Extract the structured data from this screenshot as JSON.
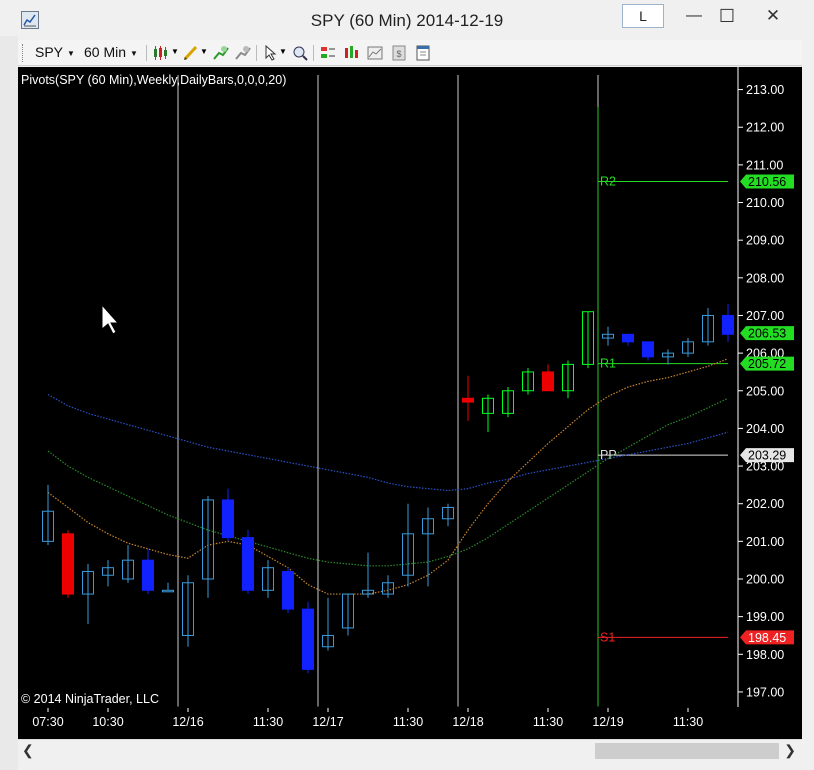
{
  "window": {
    "title": "SPY (60 Min)  2014-12-19",
    "link_button_label": "L",
    "minimize_glyph": "—",
    "maximize_glyph": "☐",
    "close_glyph": "✕"
  },
  "toolbar": {
    "instrument": "SPY",
    "interval": "60 Min",
    "icons": [
      "bar-type-icon",
      "drawing-pencil-icon",
      "add-indicator-icon",
      "remove-indicator-icon",
      "pointer-cursor-icon",
      "zoom-icon",
      "strategies-icon",
      "chart-properties-icon",
      "data-box-icon",
      "snapshot-icon",
      "template-icon"
    ]
  },
  "chart": {
    "indicator_label": "Pivots(SPY (60 Min),Weekly,DailyBars,0,0,0,20)",
    "copyright": "© 2014 NinjaTrader, LLC"
  },
  "chart_data": {
    "type": "candlestick",
    "instrument": "SPY",
    "interval": "60 Min",
    "ylim": [
      196.6,
      213.6
    ],
    "y_ticks": [
      "213.00",
      "212.00",
      "211.00",
      "210.00",
      "209.00",
      "208.00",
      "207.00",
      "206.00",
      "205.00",
      "204.00",
      "203.00",
      "202.00",
      "201.00",
      "200.00",
      "199.00",
      "198.00",
      "197.00"
    ],
    "x_labels": [
      {
        "label": "07:30",
        "bar": 0
      },
      {
        "label": "10:30",
        "bar": 3
      },
      {
        "label": "12/16",
        "bar": 7
      },
      {
        "label": "11:30",
        "bar": 11
      },
      {
        "label": "12/17",
        "bar": 14
      },
      {
        "label": "11:30",
        "bar": 18
      },
      {
        "label": "12/18",
        "bar": 21
      },
      {
        "label": "11:30",
        "bar": 25
      },
      {
        "label": "12/19",
        "bar": 28
      },
      {
        "label": "11:30",
        "bar": 32
      }
    ],
    "session_breaks": [
      6.5,
      13.5,
      20.5,
      27.5
    ],
    "candles": [
      {
        "o": 201.0,
        "h": 202.5,
        "l": 200.9,
        "c": 201.8
      },
      {
        "o": 201.2,
        "h": 201.3,
        "l": 199.5,
        "c": 199.6
      },
      {
        "o": 199.6,
        "h": 200.4,
        "l": 198.8,
        "c": 200.2
      },
      {
        "o": 200.1,
        "h": 200.5,
        "l": 199.8,
        "c": 200.3
      },
      {
        "o": 200.0,
        "h": 200.9,
        "l": 199.9,
        "c": 200.5
      },
      {
        "o": 200.5,
        "h": 200.8,
        "l": 199.6,
        "c": 199.7
      },
      {
        "o": 199.7,
        "h": 199.9,
        "l": 199.7,
        "c": 199.7
      },
      {
        "o": 198.5,
        "h": 200.1,
        "l": 198.2,
        "c": 199.9
      },
      {
        "o": 200.0,
        "h": 202.2,
        "l": 199.5,
        "c": 202.1
      },
      {
        "o": 202.1,
        "h": 202.4,
        "l": 201.0,
        "c": 201.1
      },
      {
        "o": 201.1,
        "h": 201.3,
        "l": 199.6,
        "c": 199.7
      },
      {
        "o": 199.7,
        "h": 200.5,
        "l": 199.5,
        "c": 200.3
      },
      {
        "o": 200.2,
        "h": 200.3,
        "l": 199.1,
        "c": 199.2
      },
      {
        "o": 199.2,
        "h": 199.4,
        "l": 197.5,
        "c": 197.6
      },
      {
        "o": 198.2,
        "h": 199.5,
        "l": 198.1,
        "c": 198.5
      },
      {
        "o": 198.7,
        "h": 199.6,
        "l": 198.5,
        "c": 199.6
      },
      {
        "o": 199.6,
        "h": 200.7,
        "l": 199.5,
        "c": 199.7
      },
      {
        "o": 199.6,
        "h": 200.1,
        "l": 199.5,
        "c": 199.9
      },
      {
        "o": 200.1,
        "h": 202.0,
        "l": 199.8,
        "c": 201.2
      },
      {
        "o": 201.2,
        "h": 201.9,
        "l": 199.8,
        "c": 201.6
      },
      {
        "o": 201.6,
        "h": 202.0,
        "l": 201.4,
        "c": 201.9
      },
      {
        "o": 204.8,
        "h": 205.4,
        "l": 204.2,
        "c": 204.7
      },
      {
        "o": 204.4,
        "h": 204.9,
        "l": 203.9,
        "c": 204.8
      },
      {
        "o": 204.4,
        "h": 205.1,
        "l": 204.3,
        "c": 205.0
      },
      {
        "o": 205.0,
        "h": 205.6,
        "l": 204.9,
        "c": 205.5
      },
      {
        "o": 205.5,
        "h": 205.7,
        "l": 205.0,
        "c": 205.0
      },
      {
        "o": 205.0,
        "h": 205.8,
        "l": 204.8,
        "c": 205.7
      },
      {
        "o": 205.7,
        "h": 207.1,
        "l": 205.6,
        "c": 207.1
      },
      {
        "o": 206.4,
        "h": 206.7,
        "l": 206.2,
        "c": 206.5
      },
      {
        "o": 206.5,
        "h": 206.5,
        "l": 206.2,
        "c": 206.3
      },
      {
        "o": 206.3,
        "h": 206.3,
        "l": 205.8,
        "c": 205.9
      },
      {
        "o": 205.9,
        "h": 206.1,
        "l": 205.7,
        "c": 206.0
      },
      {
        "o": 206.0,
        "h": 206.4,
        "l": 205.9,
        "c": 206.3
      },
      {
        "o": 206.3,
        "h": 207.2,
        "l": 206.2,
        "c": 207.0
      },
      {
        "o": 207.0,
        "h": 207.3,
        "l": 206.3,
        "c": 206.5
      }
    ],
    "colors": {
      "up_body": "#00ff22",
      "down_body": "#ee0000",
      "up_prev_session": "#3a9bdc",
      "down_prev_session": "#1122ff",
      "axis_text": "#ffffff",
      "session_line": "#cccccc"
    },
    "moving_averages": [
      {
        "color": "#2a52c8",
        "values": [
          204.9,
          204.6,
          204.4,
          204.25,
          204.1,
          203.95,
          203.8,
          203.65,
          203.5,
          203.4,
          203.3,
          203.2,
          203.1,
          203.0,
          202.9,
          202.8,
          202.7,
          202.55,
          202.45,
          202.4,
          202.35,
          202.4,
          202.55,
          202.65,
          202.8,
          202.9,
          203.0,
          203.1,
          203.2,
          203.3,
          203.4,
          203.5,
          203.6,
          203.75,
          203.9
        ]
      },
      {
        "color": "#2a8a2a",
        "values": [
          203.4,
          203.0,
          202.7,
          202.45,
          202.2,
          201.95,
          201.7,
          201.5,
          201.3,
          201.15,
          201.0,
          200.85,
          200.7,
          200.55,
          200.45,
          200.4,
          200.35,
          200.35,
          200.4,
          200.45,
          200.6,
          200.8,
          201.1,
          201.45,
          201.8,
          202.15,
          202.5,
          202.85,
          203.2,
          203.5,
          203.8,
          204.1,
          204.3,
          204.55,
          204.8
        ]
      },
      {
        "color": "#c7852b",
        "values": [
          202.3,
          201.9,
          201.5,
          201.2,
          200.95,
          200.8,
          200.65,
          200.55,
          200.9,
          201.0,
          200.9,
          200.6,
          200.3,
          199.85,
          199.6,
          199.6,
          199.6,
          199.7,
          199.85,
          200.1,
          200.5,
          201.3,
          202.0,
          202.6,
          203.1,
          203.6,
          204.05,
          204.5,
          204.85,
          205.1,
          205.25,
          205.35,
          205.5,
          205.65,
          205.85
        ]
      }
    ],
    "pivot_levels": [
      {
        "name": "R2",
        "value": 210.56,
        "label": "210.56",
        "color": "#22dd22",
        "label_bg": "#22dd22",
        "label_fg": "#000000"
      },
      {
        "name": "R1",
        "value": 205.72,
        "label": "205.72",
        "color": "#22dd22",
        "label_bg": "#22dd22",
        "label_fg": "#000000"
      },
      {
        "name": "PP",
        "value": 203.29,
        "label": "203.29",
        "color": "#dddddd",
        "label_bg": "#e6e6e6",
        "label_fg": "#000000"
      },
      {
        "name": "S1",
        "value": 198.45,
        "label": "198.45",
        "color": "#ee2222",
        "label_bg": "#ee2222",
        "label_fg": "#ffffff"
      }
    ],
    "last_price": {
      "value": 206.53,
      "label": "206.53",
      "bg": "#22dd22",
      "fg": "#000000"
    },
    "pivot_start_bar": 28
  },
  "scrollbar": {
    "left_glyph": "❮",
    "right_glyph": "❯"
  }
}
